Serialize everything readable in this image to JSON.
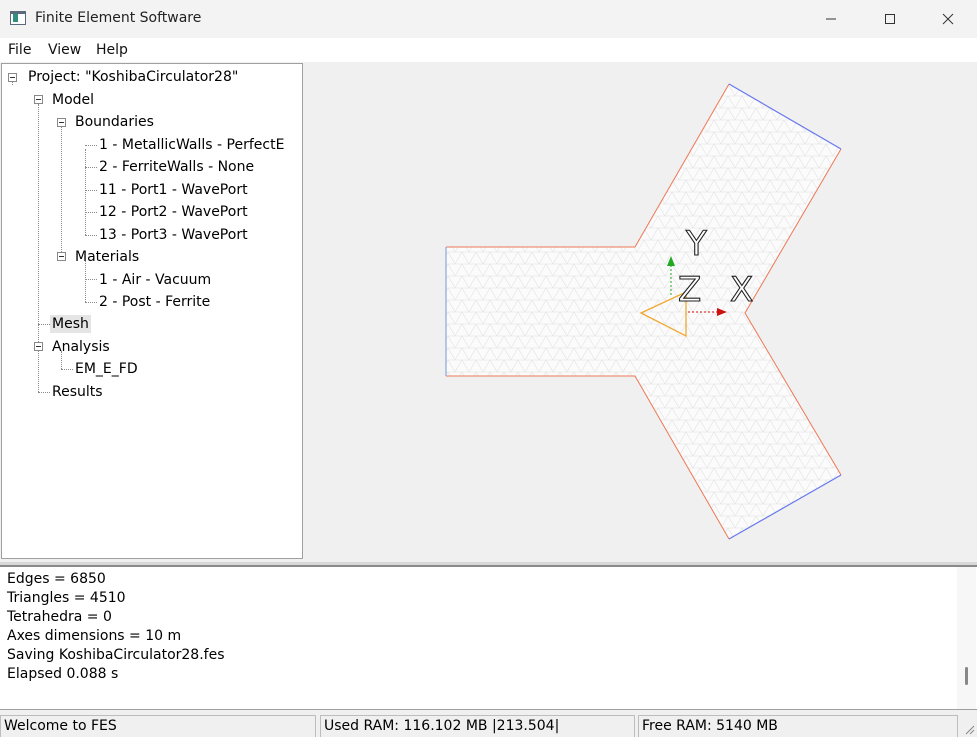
{
  "window": {
    "title": "Finite Element Software",
    "controls": [
      "minimize-icon",
      "maximize-icon",
      "close-icon"
    ]
  },
  "menu": {
    "items": [
      "File",
      "View",
      "Help"
    ]
  },
  "tree": {
    "root_label": "Project: \"KoshibaCirculator28\"",
    "model_label": "Model",
    "boundaries_label": "Boundaries",
    "boundaries": [
      "1 - MetallicWalls - PerfectE",
      "2 - FerriteWalls - None",
      "11 - Port1 - WavePort",
      "12 - Port2 - WavePort",
      "13 - Port3 - WavePort"
    ],
    "materials_label": "Materials",
    "materials": [
      "1 - Air - Vacuum",
      "2 - Post - Ferrite"
    ],
    "mesh_label": "Mesh",
    "analysis_label": "Analysis",
    "analysis_items": [
      "EM_E_FD"
    ],
    "results_label": "Results"
  },
  "viewport": {
    "axes": {
      "y": "Y",
      "z": "Z",
      "x": "X"
    },
    "colors": {
      "walls": "#ee7755",
      "ports": "#6677ee",
      "port1": "#88aadd",
      "mesh_fill": "#fdfdfd",
      "axis_x": "#cc1111",
      "axis_y": "#22aa22",
      "post": "#f0a830"
    }
  },
  "console": {
    "lines": [
      "Edges  = 6850",
      "Triangles  = 4510",
      "Tetrahedra = 0",
      "Axes dimensions = 10 m",
      "Saving KoshibaCirculator28.fes",
      "Elapsed 0.088 s"
    ]
  },
  "status": {
    "welcome": "Welcome to FES",
    "used_ram": "Used RAM: 116.102 MB |213.504|",
    "free_ram": "Free RAM: 5140 MB"
  }
}
